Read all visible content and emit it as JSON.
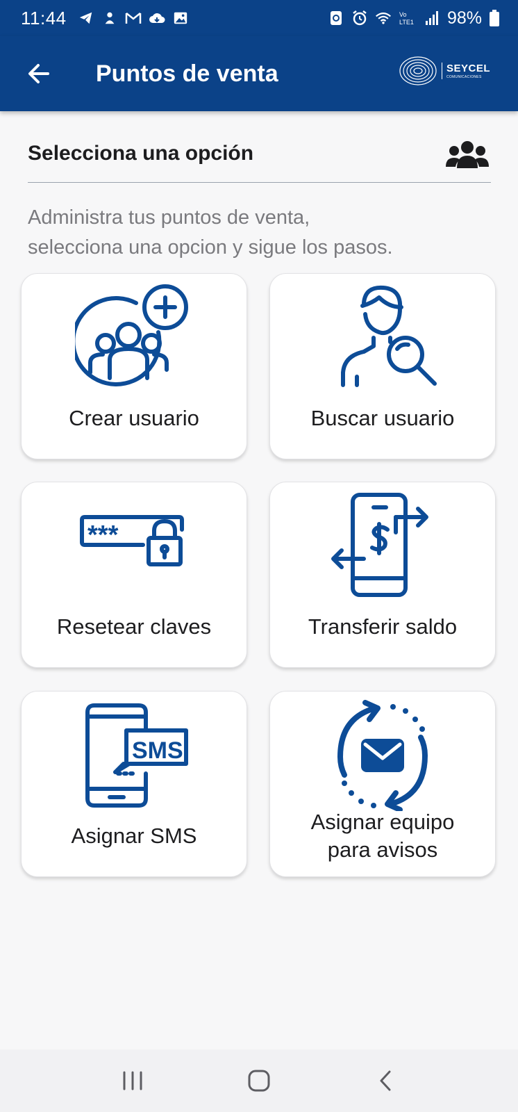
{
  "status_bar": {
    "time": "11:44",
    "battery": "98%",
    "left_icons": [
      "telegram-icon",
      "notification-icon",
      "gmail-icon",
      "cloud-icon",
      "gallery-icon"
    ],
    "right_icons": [
      "recycle-icon",
      "alarm-icon",
      "wifi-icon",
      "volte-icon",
      "signal-icon",
      "battery-icon"
    ]
  },
  "app_bar": {
    "title": "Puntos de venta",
    "logo_name": "SEYCEL",
    "logo_subtitle": "COMUNICACIONES"
  },
  "section": {
    "title": "Selecciona una opción",
    "description_line1": "Administra tus puntos de venta,",
    "description_line2": "selecciona una opcion y sigue los pasos."
  },
  "options": [
    {
      "label": "Crear usuario",
      "icon": "add-users-icon"
    },
    {
      "label": "Buscar usuario",
      "icon": "search-user-icon"
    },
    {
      "label": "Resetear claves",
      "icon": "password-lock-icon"
    },
    {
      "label": "Transferir saldo",
      "icon": "money-transfer-icon"
    },
    {
      "label": "Asignar SMS",
      "icon": "sms-phone-icon"
    },
    {
      "label_line1": "Asignar equipo",
      "label_line2": "para avisos",
      "icon": "mail-sync-icon"
    }
  ],
  "colors": {
    "primary": "#0b4288",
    "icon_blue": "#0d4c97",
    "background": "#f7f7f8",
    "card": "#ffffff"
  }
}
